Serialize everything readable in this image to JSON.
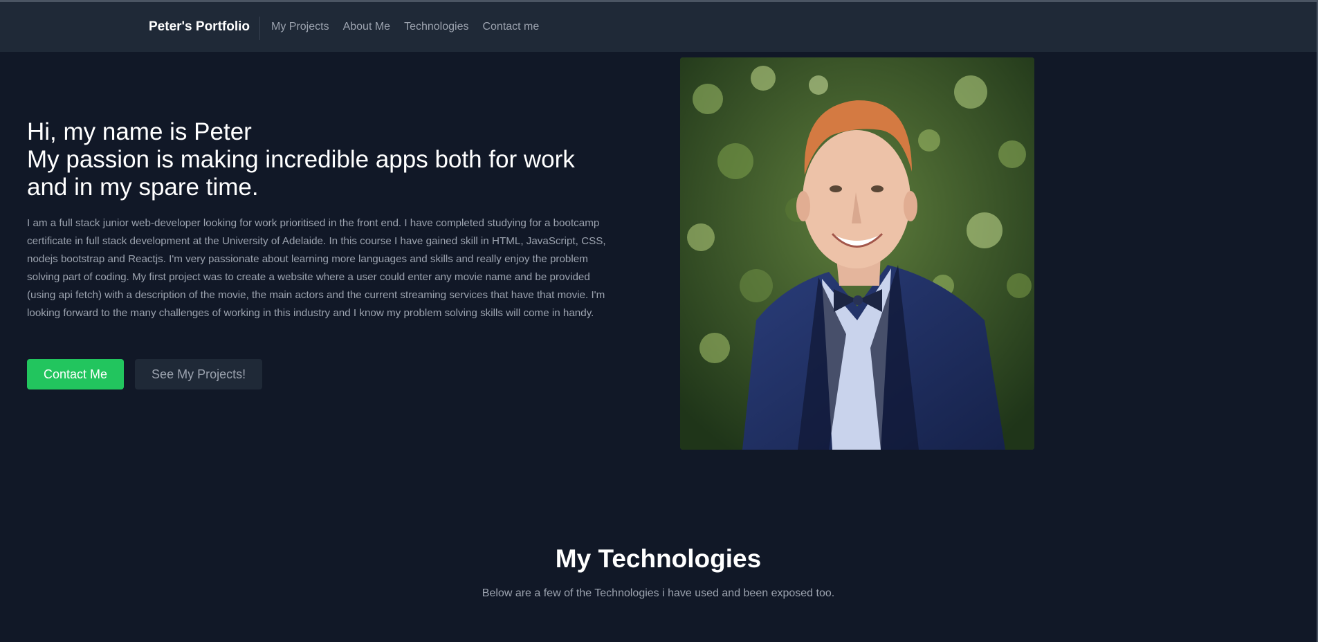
{
  "navbar": {
    "brand": "Peter's Portfolio",
    "links": [
      "My Projects",
      "About Me",
      "Technologies",
      "Contact me"
    ]
  },
  "hero": {
    "heading_line1": "Hi, my name is Peter",
    "heading_line2": "My passion is making incredible apps both for work and in my spare time.",
    "body": "I am a full stack junior web-developer looking for work prioritised in the front end. I have completed studying for a bootcamp certificate in full stack development at the University of Adelaide. In this course I have gained skill in HTML, JavaScript, CSS, nodejs bootstrap and Reactjs. I'm very passionate about learning more languages and skills and really enjoy the problem solving part of coding. My first project was to create a website where a user could enter any movie name and be provided (using api fetch) with a description of the movie, the main actors and the current streaming services that have that movie. I'm looking forward to the many challenges of working in this industry and I know my problem solving skills will come in handy.",
    "primary_button": "Contact Me",
    "secondary_button": "See My Projects!"
  },
  "technologies": {
    "title": "My Technologies",
    "subtitle": "Below are a few of the Technologies i have used and been exposed too."
  },
  "colors": {
    "background": "#111827",
    "navbar": "#1f2937",
    "accent": "#22c55e",
    "muted_text": "#9ca3af"
  }
}
